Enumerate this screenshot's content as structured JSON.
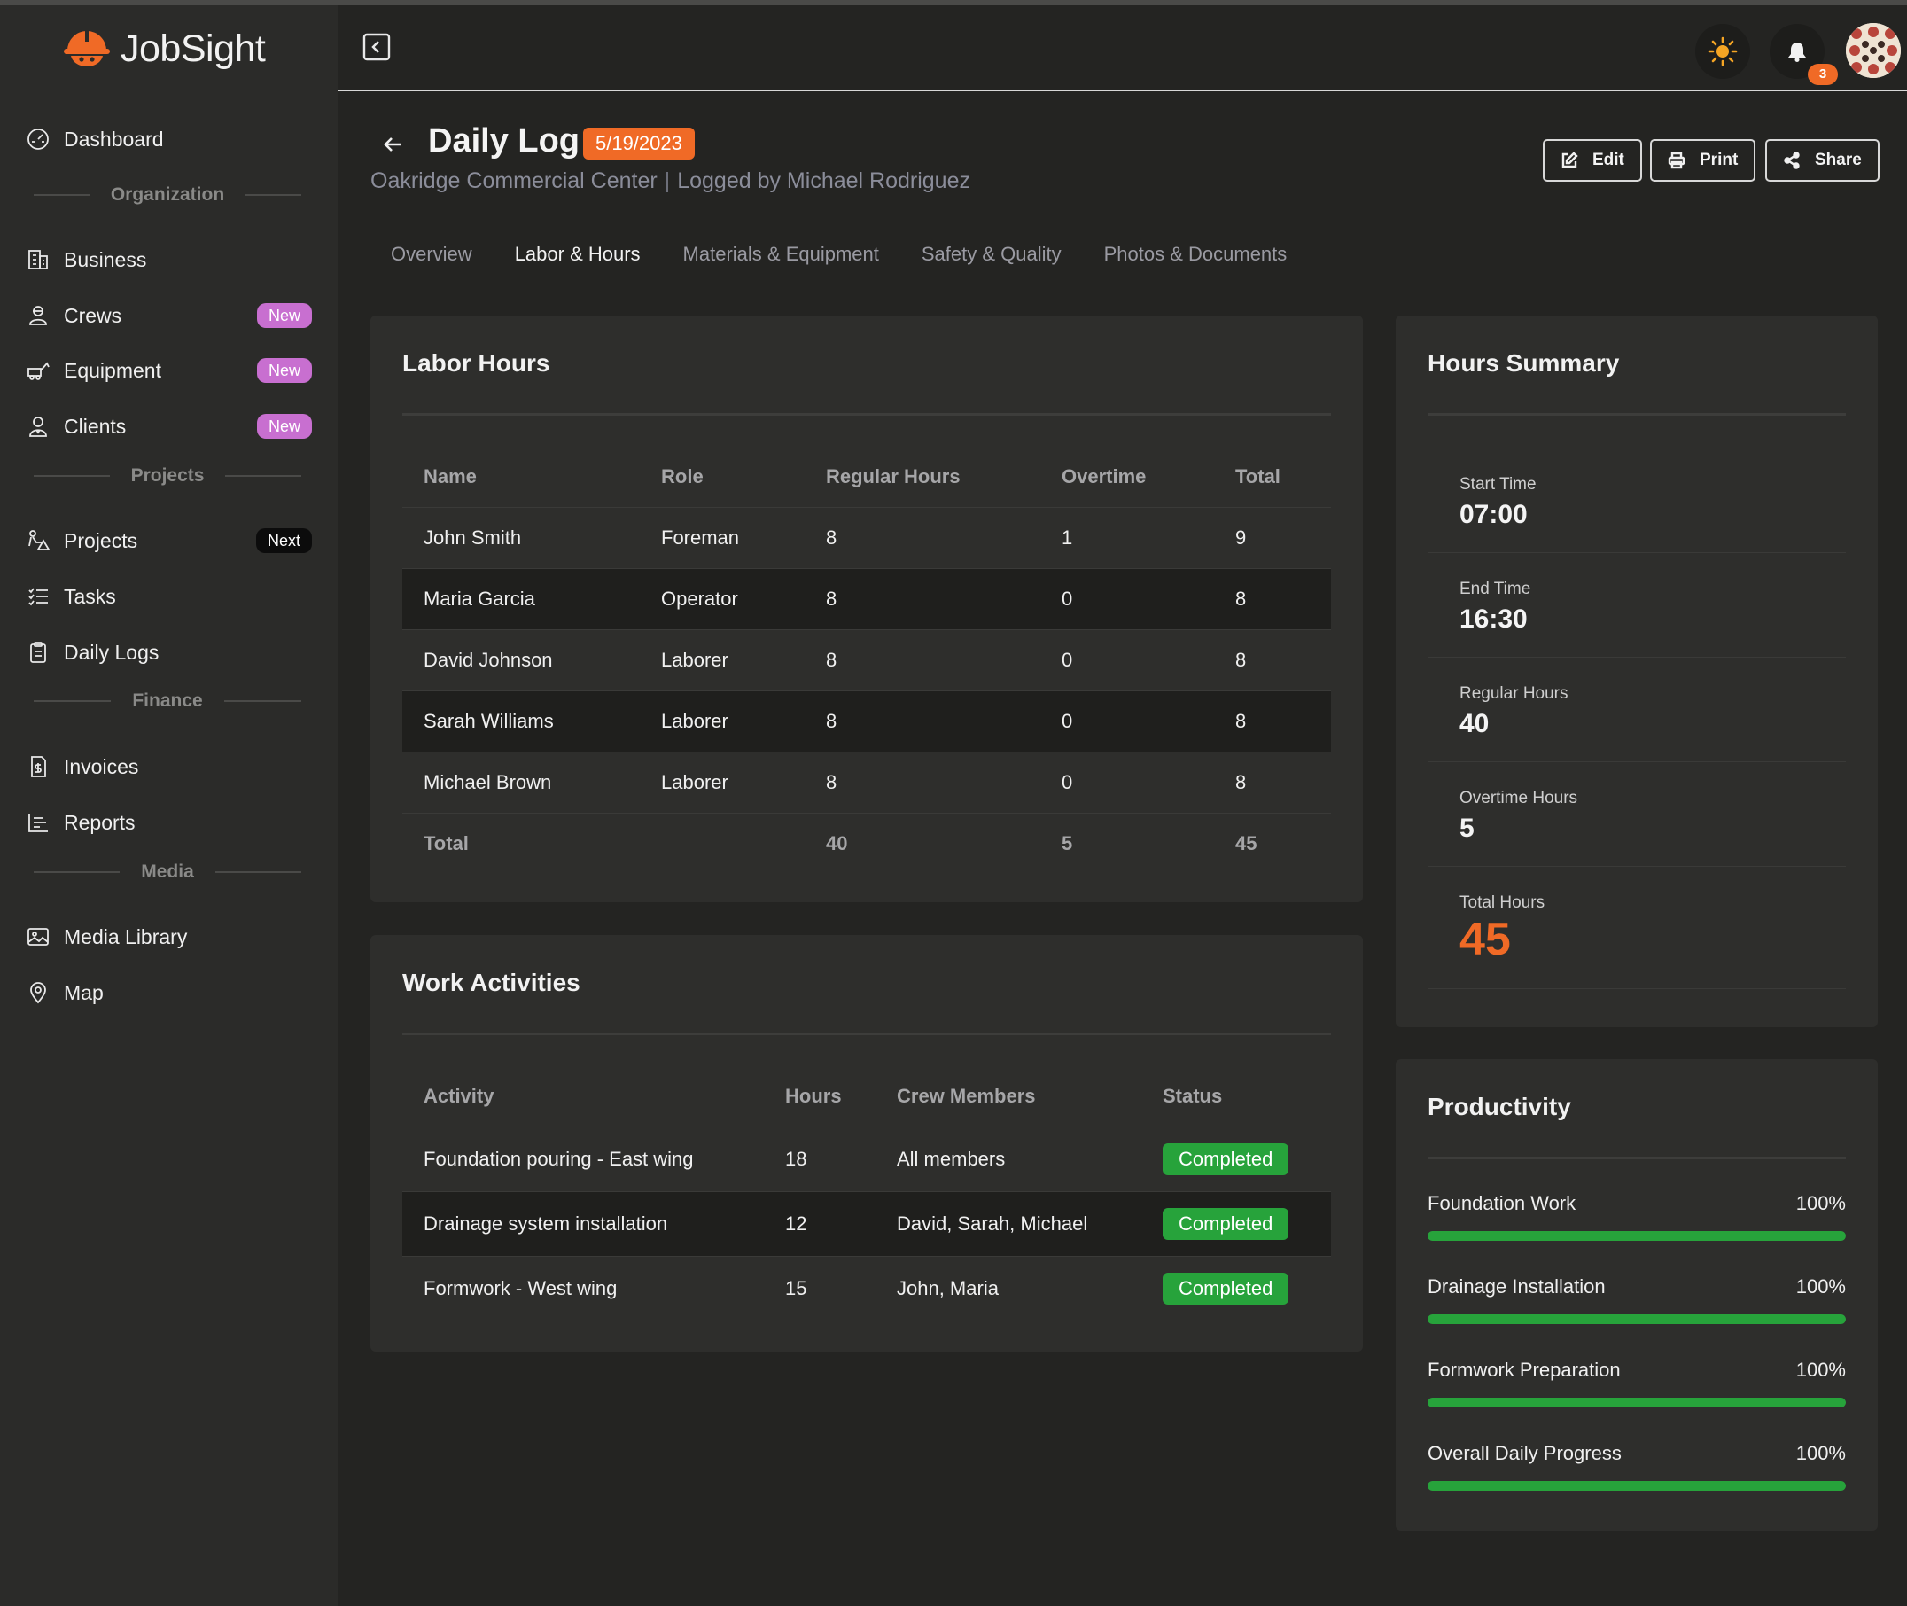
{
  "app": {
    "brand": "JobSight"
  },
  "colors": {
    "accent": "#f06a26",
    "success": "#27a33b",
    "badge_new": "#c86fd0"
  },
  "header": {
    "notifications_count": "3"
  },
  "sidebar": {
    "items": [
      {
        "label": "Dashboard",
        "icon": "dashboard-icon"
      },
      {
        "section": "Organization"
      },
      {
        "label": "Business",
        "icon": "building-icon"
      },
      {
        "label": "Crews",
        "icon": "crew-icon",
        "badge": "New"
      },
      {
        "label": "Equipment",
        "icon": "equipment-icon",
        "badge": "New"
      },
      {
        "label": "Clients",
        "icon": "client-icon",
        "badge": "New"
      },
      {
        "section": "Projects"
      },
      {
        "label": "Projects",
        "icon": "projects-icon",
        "badge": "Next"
      },
      {
        "label": "Tasks",
        "icon": "tasks-icon"
      },
      {
        "label": "Daily Logs",
        "icon": "clipboard-icon"
      },
      {
        "section": "Finance"
      },
      {
        "label": "Invoices",
        "icon": "invoice-icon"
      },
      {
        "label": "Reports",
        "icon": "reports-icon"
      },
      {
        "section": "Media"
      },
      {
        "label": "Media Library",
        "icon": "image-icon"
      },
      {
        "label": "Map",
        "icon": "map-pin-icon"
      }
    ]
  },
  "page": {
    "title": "Daily Log",
    "date": "5/19/2023",
    "project": "Oakridge Commercial Center",
    "logged_by": "Logged by Michael Rodriguez",
    "separator": "|",
    "actions": {
      "edit": "Edit",
      "print": "Print",
      "share": "Share"
    },
    "tabs": [
      "Overview",
      "Labor & Hours",
      "Materials & Equipment",
      "Safety & Quality",
      "Photos & Documents"
    ],
    "active_tab": 1
  },
  "labor": {
    "title": "Labor Hours",
    "headers": [
      "Name",
      "Role",
      "Regular Hours",
      "Overtime",
      "Total"
    ],
    "rows": [
      [
        "John Smith",
        "Foreman",
        "8",
        "1",
        "9"
      ],
      [
        "Maria Garcia",
        "Operator",
        "8",
        "0",
        "8"
      ],
      [
        "David Johnson",
        "Laborer",
        "8",
        "0",
        "8"
      ],
      [
        "Sarah Williams",
        "Laborer",
        "8",
        "0",
        "8"
      ],
      [
        "Michael Brown",
        "Laborer",
        "8",
        "0",
        "8"
      ]
    ],
    "total_row": [
      "Total",
      "",
      "40",
      "5",
      "45"
    ]
  },
  "activities": {
    "title": "Work Activities",
    "headers": [
      "Activity",
      "Hours",
      "Crew Members",
      "Status"
    ],
    "rows": [
      [
        "Foundation pouring - East wing",
        "18",
        "All members",
        "Completed"
      ],
      [
        "Drainage system installation",
        "12",
        "David, Sarah, Michael",
        "Completed"
      ],
      [
        "Formwork - West wing",
        "15",
        "John, Maria",
        "Completed"
      ]
    ]
  },
  "summary": {
    "title": "Hours Summary",
    "items": [
      {
        "label": "Start Time",
        "value": "07:00"
      },
      {
        "label": "End Time",
        "value": "16:30"
      },
      {
        "label": "Regular Hours",
        "value": "40"
      },
      {
        "label": "Overtime Hours",
        "value": "5"
      },
      {
        "label": "Total Hours",
        "value": "45"
      }
    ]
  },
  "productivity": {
    "title": "Productivity",
    "items": [
      {
        "label": "Foundation Work",
        "pct_text": "100%",
        "progress": 1.0
      },
      {
        "label": "Drainage Installation",
        "pct_text": "100%",
        "progress": 1.0
      },
      {
        "label": "Formwork Preparation",
        "pct_text": "100%",
        "progress": 1.0
      },
      {
        "label": "Overall Daily Progress",
        "pct_text": "100%",
        "progress": 1.0
      }
    ]
  }
}
